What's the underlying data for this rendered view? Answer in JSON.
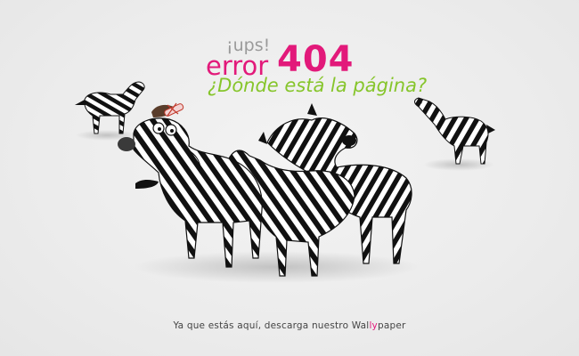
{
  "headline": {
    "exclaim": "¡ups!",
    "error_word": "error",
    "error_code": "404",
    "question": "¿Dónde está la página?"
  },
  "footer": {
    "text_before": "Ya que estás aquí, descarga nuestro ",
    "link_part1": "Wal",
    "link_highlight": "ly",
    "link_part2": "paper"
  },
  "colors": {
    "error": "#e2197a",
    "question": "#86c52b",
    "exclaim": "#9a9a9a",
    "background": "#ececec",
    "stripe": "#111111"
  },
  "illustration": {
    "subject": "herd of cartoon zebras",
    "icons": [
      "zebra-icon",
      "confused-zebra-with-bandage-icon"
    ]
  }
}
